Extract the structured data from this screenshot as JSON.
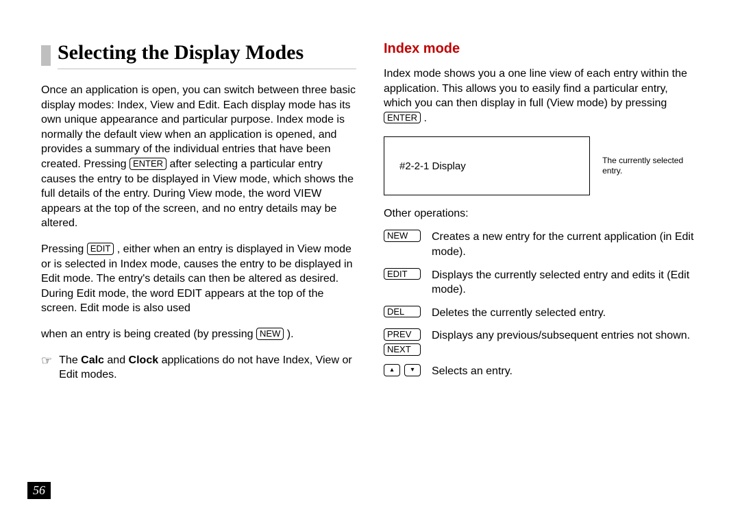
{
  "left": {
    "title": "Selecting the Display Modes",
    "p1a": "Once an application is open, you can switch between three basic display modes: Index, View and Edit. Each display mode has its own unique appearance and particular purpose. Index mode is normally the default view when an application is opened, and provides a summary of the individual entries that have been created. Pressing ",
    "p1_key": "ENTER",
    "p1b": " after selecting a particular entry causes the entry to be displayed in View mode, which shows the full details of the entry. During View mode, the word VIEW appears at the top of the screen, and no entry details may be altered.",
    "p2a": "Pressing ",
    "p2_key": "EDIT",
    "p2b": " , either when an entry is displayed in View mode or is selected in Index mode, causes the entry to be displayed in Edit mode. The entry's details can then be altered as desired. During Edit mode, the word EDIT appears at the top of the screen. Edit mode is also used",
    "p3a": "when an entry is being created (by pressing ",
    "p3_key": "NEW",
    "p3b": " ).",
    "note_a": "The ",
    "note_b1": "Calc",
    "note_mid": " and ",
    "note_b2": "Clock",
    "note_c": " applications do not have Index, View or Edit modes."
  },
  "right": {
    "title": "Index mode",
    "intro_a": "Index mode shows you a one line view of each entry within the application. This allows you to easily find a particular entry, which you can then display in full (View mode) by pressing ",
    "intro_key": "ENTER",
    "intro_b": " .",
    "box_text": "#2-2-1 Display",
    "box_caption": "The currently selected entry.",
    "ops_title": "Other operations:",
    "ops": [
      {
        "keys": [
          "NEW"
        ],
        "desc": "Creates a new entry for the current application (in Edit mode)."
      },
      {
        "keys": [
          "EDIT"
        ],
        "desc": "Displays the currently selected entry and edits it (Edit mode)."
      },
      {
        "keys": [
          "DEL"
        ],
        "desc": "Deletes the currently selected entry."
      },
      {
        "keys": [
          "PREV",
          "NEXT"
        ],
        "desc": "Displays any previous/subsequent entries not shown."
      }
    ],
    "arrow_desc": "Selects an entry."
  },
  "page_number": "56"
}
